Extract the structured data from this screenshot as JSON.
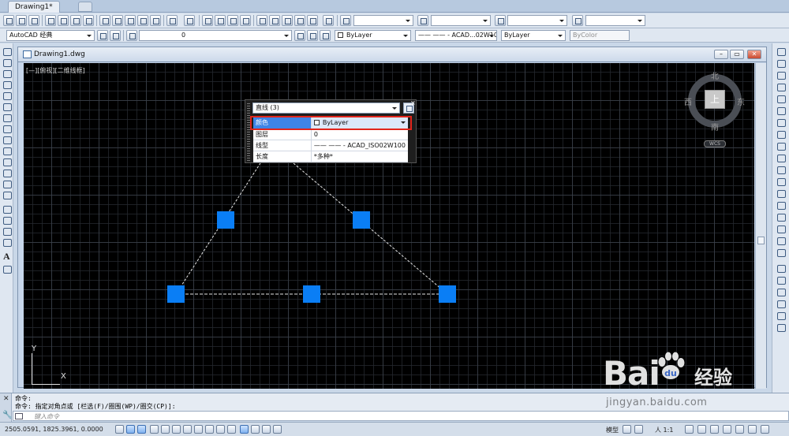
{
  "app": {
    "tab_title": "Drawing1*",
    "window_title": "Drawing1.dwg"
  },
  "toolbar": {
    "workspace": "AutoCAD 经典",
    "layer_value": "0",
    "color_value": "ByLayer",
    "linetype_value": "—— —— - ACAD...02W100",
    "lineweight_value": "ByLayer",
    "plotstyle_value": "ByColor"
  },
  "viewport": {
    "label": "[—][俯视][二维线框]"
  },
  "viewcube": {
    "north": "北",
    "south": "南",
    "west": "西",
    "east": "东",
    "face": "上",
    "wcs": "WCS"
  },
  "ucs": {
    "x_label": "X",
    "y_label": "Y"
  },
  "quick_properties": {
    "selection": "直线 (3)",
    "rows": [
      {
        "key": "颜色",
        "value": "ByLayer",
        "swatch": true
      },
      {
        "key": "图层",
        "value": "0"
      },
      {
        "key": "线型",
        "value": "—— —— - ACAD_ISO02W100"
      },
      {
        "key": "长度",
        "value": "*多种*"
      }
    ]
  },
  "command": {
    "history": [
      "命令:",
      "命令: 指定对角点或 [栏选(F)/圈围(WP)/圈交(CP)]:"
    ],
    "placeholder": "键入命令"
  },
  "status": {
    "coords": "2505.0591, 1825.3961, 0.0000",
    "model_label": "模型",
    "scale_label": "人 1:1"
  },
  "watermark": {
    "brand": "Bai",
    "brand_cn": "经验",
    "url": "jingyan.baidu.com"
  },
  "colors": {
    "grip": "#0a7ef5",
    "highlight": "#e1251b",
    "canvas": "#000000"
  }
}
